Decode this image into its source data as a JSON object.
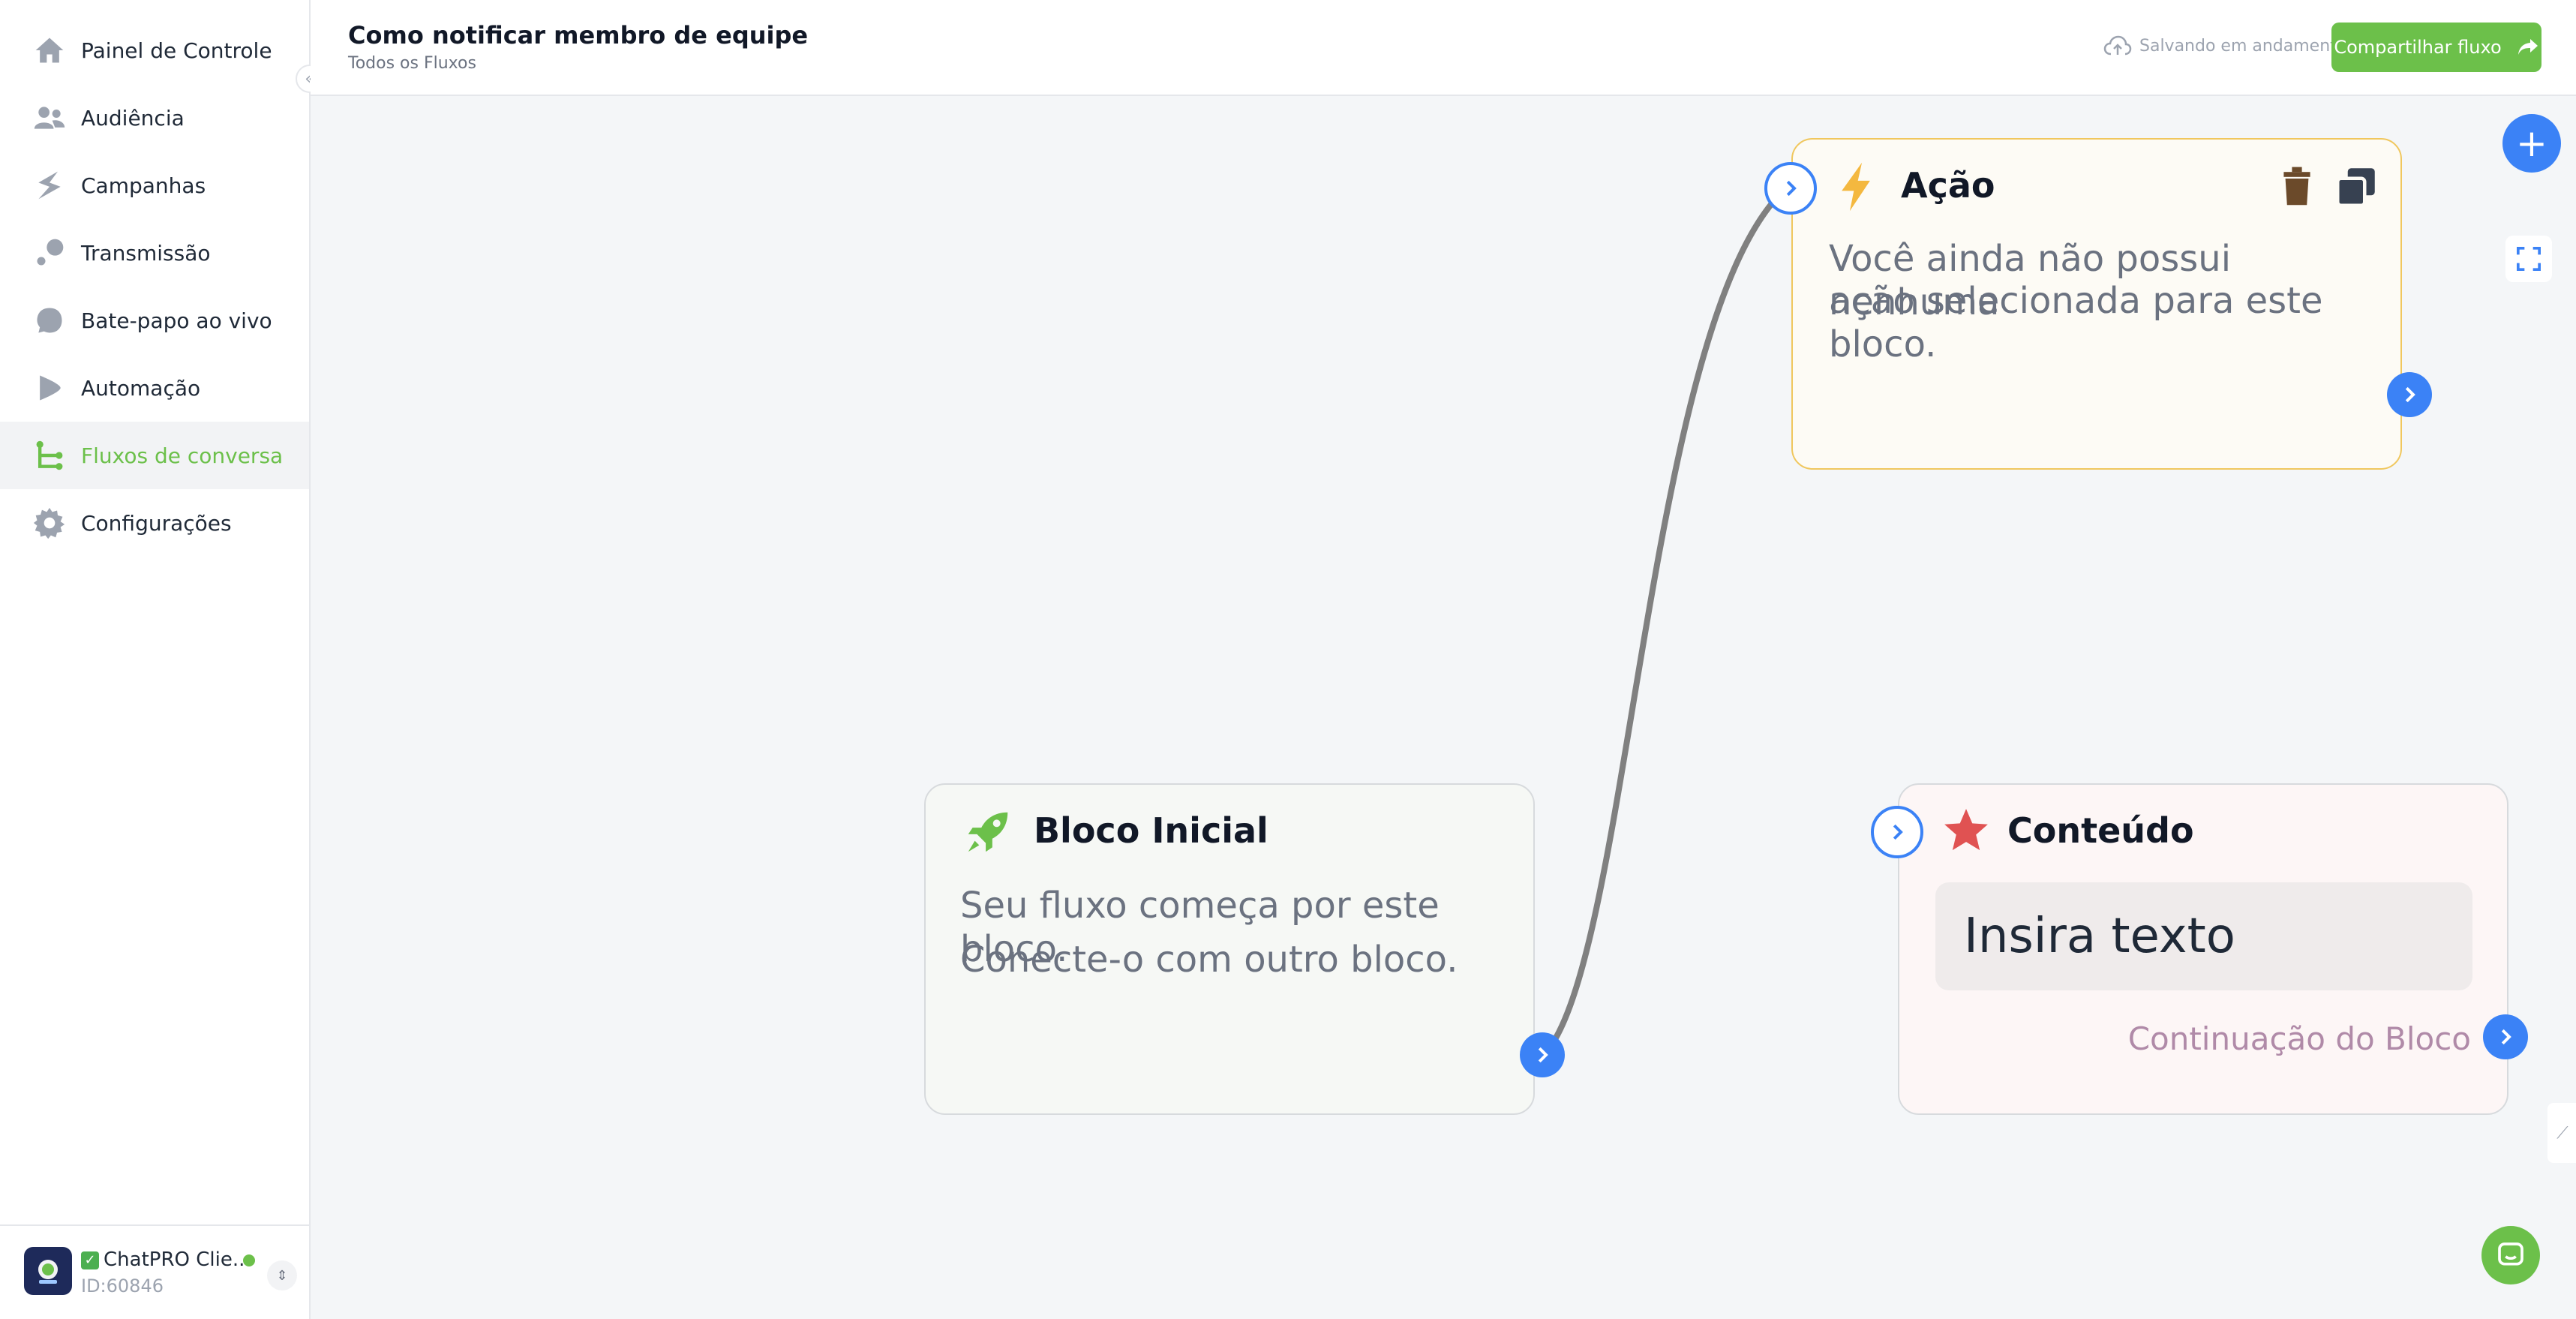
{
  "sidebar": {
    "items": [
      {
        "label": "Painel de Controle",
        "icon": "home-icon"
      },
      {
        "label": "Audiência",
        "icon": "users-icon"
      },
      {
        "label": "Campanhas",
        "icon": "campaign-icon"
      },
      {
        "label": "Transmissão",
        "icon": "broadcast-icon"
      },
      {
        "label": "Bate-papo ao vivo",
        "icon": "chat-bubble-icon"
      },
      {
        "label": "Automação",
        "icon": "automation-icon"
      },
      {
        "label": "Fluxos de conversa",
        "icon": "flow-icon",
        "active": true
      },
      {
        "label": "Configurações",
        "icon": "gear-icon"
      }
    ],
    "collapse_glyph": "«",
    "account": {
      "name": "ChatPRO Clie...",
      "check": "✓",
      "id": "ID:60846",
      "switch_glyph": "⇕"
    }
  },
  "header": {
    "title": "Como notificar membro de equipe",
    "breadcrumb": "Todos os Fluxos",
    "saving_status": "Salvando em andamento",
    "share_label": "Compartilhar fluxo"
  },
  "canvas": {
    "blocks": {
      "start": {
        "title": "Bloco Inicial",
        "text_line1": "Seu fluxo começa por este bloco.",
        "text_line2": "Conecte-o com outro bloco."
      },
      "action": {
        "title": "Ação",
        "text_line1": "Você ainda não possui nenhuma",
        "text_line2": "ação selecionada para este bloco."
      },
      "content": {
        "title": "Conteúdo",
        "input_text": "Insira texto",
        "continuation": "Continuação do Bloco"
      }
    },
    "add_glyph": "+",
    "minimap_glyph": "⟋"
  },
  "colors": {
    "accent_green": "#6cc04a",
    "port_blue": "#3b82f6",
    "action_border": "#f0c75e",
    "content_star": "#e05252",
    "bolt_yellow": "#f4b83f"
  }
}
